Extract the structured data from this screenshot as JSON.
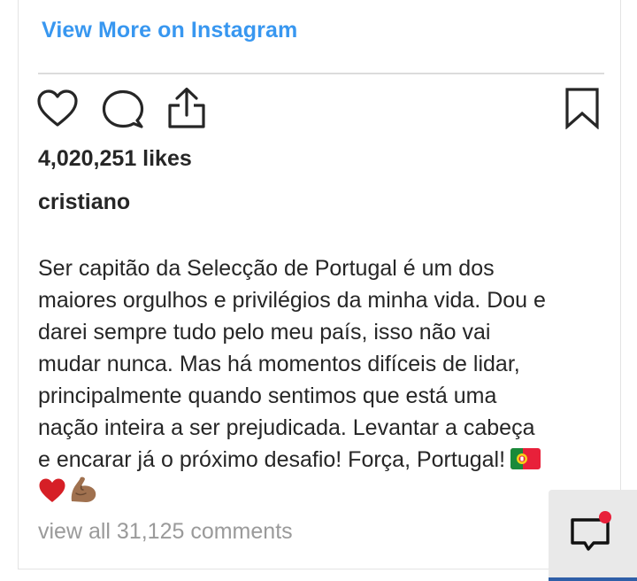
{
  "link": {
    "view_more": "View More on Instagram"
  },
  "actions": {
    "like_icon": "heart-icon",
    "comment_icon": "comment-bubble-icon",
    "share_icon": "share-upload-icon",
    "save_icon": "bookmark-icon"
  },
  "post": {
    "likes": "4,020,251 likes",
    "username": "cristiano",
    "caption_lines": [
      "Ser capitão da Selecção de Portugal é um dos",
      "maiores orgulhos e privilégios da minha vida. Dou e",
      "darei sempre tudo pelo meu país, isso não vai",
      "mudar nunca. Mas há momentos difíceis de lidar,",
      "principalmente quando sentimos que está uma",
      "nação inteira a ser prejudicada. Levantar a cabeça",
      "e encarar já o próximo desafio! Força, Portugal!"
    ],
    "caption_emojis": [
      "portugal-flag-emoji",
      "red-heart-emoji",
      "flexed-biceps-emoji"
    ],
    "comments": "view all 31,125 comments"
  },
  "chat_widget": {
    "icon": "chat-bubble-icon",
    "has_notification": true,
    "notification_color": "#e8203a"
  },
  "colors": {
    "link": "#3897f0",
    "text": "#262626",
    "muted": "#9a9a9a"
  }
}
